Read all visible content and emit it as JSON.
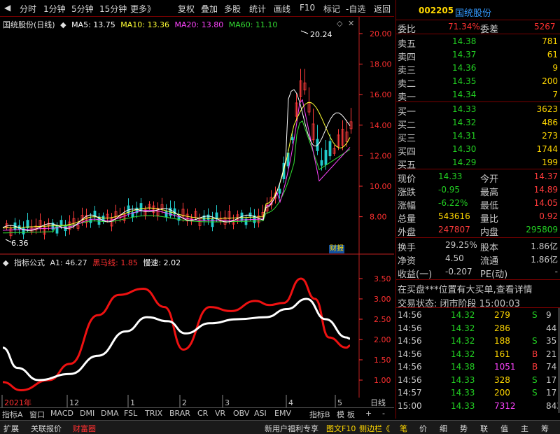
{
  "toolbar": {
    "items": [
      "分时",
      "1分钟",
      "5分钟",
      "15分钟",
      "更多》",
      "复权",
      "叠加",
      "多股",
      "统计",
      "画线",
      "F10",
      "标记",
      "-自选",
      "返回"
    ]
  },
  "stock": {
    "code": "002205",
    "name": "国统股份"
  },
  "price_legend": {
    "title": "国统股份(日线)",
    "ma5": "MA5: 13.75",
    "ma10": "MA10: 13.36",
    "ma20": "MA20: 13.80",
    "ma60": "MA60: 11.10",
    "high_label": "20.24",
    "low_label": "6.36",
    "badge": "财报"
  },
  "indicator_legend": {
    "title": "指标公式",
    "a1": "A1: 46.27",
    "hmx": "黑马线: 1.85",
    "ms": "慢速: 2.02"
  },
  "price_axis": [
    "20.00",
    "18.00",
    "16.00",
    "14.00",
    "12.00",
    "10.00",
    "8.00"
  ],
  "ind_axis": [
    "3.50",
    "3.00",
    "2.50",
    "2.00",
    "1.50",
    "1.00"
  ],
  "time_axis": [
    "2021年",
    "12",
    "1",
    "2",
    "3",
    "4",
    "5",
    "日线"
  ],
  "indicator_tabs": [
    "指标A",
    "窗口",
    "MACD",
    "DMI",
    "DMA",
    "FSL",
    "TRIX",
    "BRAR",
    "CR",
    "VR",
    "OBV",
    "ASI",
    "EMV",
    "指标B",
    "模",
    "板",
    "+",
    "-"
  ],
  "status_bar": {
    "left": [
      "扩展",
      "关联报价",
      "财富圈"
    ],
    "middle": [
      "新用户福利专享",
      "图文F10",
      "侧边栏《"
    ],
    "right": [
      "笔",
      "价",
      "细",
      "势",
      "联",
      "值",
      "主",
      "筹"
    ]
  },
  "quote": {
    "weibi_label": "委比",
    "weibi": "71.34%",
    "weicha_label": "委差",
    "weicha": "5267",
    "asks": [
      {
        "label": "卖五",
        "price": "14.38",
        "vol": "781"
      },
      {
        "label": "卖四",
        "price": "14.37",
        "vol": "61"
      },
      {
        "label": "卖三",
        "price": "14.36",
        "vol": "9"
      },
      {
        "label": "卖二",
        "price": "14.35",
        "vol": "200"
      },
      {
        "label": "卖一",
        "price": "14.34",
        "vol": "7"
      }
    ],
    "bids": [
      {
        "label": "买一",
        "price": "14.33",
        "vol": "3623"
      },
      {
        "label": "买二",
        "price": "14.32",
        "vol": "486"
      },
      {
        "label": "买三",
        "price": "14.31",
        "vol": "273"
      },
      {
        "label": "买四",
        "price": "14.30",
        "vol": "1744"
      },
      {
        "label": "买五",
        "price": "14.29",
        "vol": "199"
      }
    ],
    "stats": [
      {
        "l1": "现价",
        "v1": "14.33",
        "l2": "今开",
        "v2": "14.37"
      },
      {
        "l1": "涨跌",
        "v1": "-0.95",
        "l2": "最高",
        "v2": "14.89"
      },
      {
        "l1": "涨幅",
        "v1": "-6.22%",
        "l2": "最低",
        "v2": "14.05"
      },
      {
        "l1": "总量",
        "v1": "543616",
        "l2": "量比",
        "v2": "0.92"
      },
      {
        "l1": "外盘",
        "v1": "247807",
        "l2": "内盘",
        "v2": "295809"
      }
    ],
    "stats2": [
      {
        "l1": "换手",
        "v1": "29.25%",
        "l2": "股本",
        "v2": "1.86亿"
      },
      {
        "l1": "净资",
        "v1": "4.50",
        "l2": "流通",
        "v2": "1.86亿"
      },
      {
        "l1": "收益(一)",
        "v1": "-0.207",
        "l2": "PE(动)",
        "v2": "-"
      }
    ],
    "notice": "在买盘***位置有大买单,查看详情",
    "trade_status": "交易状态: 闭市阶段 15:00:03",
    "ticks": [
      {
        "t": "14:56",
        "p": "14.32",
        "v": "279",
        "s": "S",
        "n": "9"
      },
      {
        "t": "14:56",
        "p": "14.32",
        "v": "286",
        "s": "",
        "n": "44"
      },
      {
        "t": "14:56",
        "p": "14.32",
        "v": "188",
        "s": "S",
        "n": "35"
      },
      {
        "t": "14:56",
        "p": "14.32",
        "v": "161",
        "s": "B",
        "n": "21"
      },
      {
        "t": "14:56",
        "p": "14.38",
        "v": "1051",
        "s": "B",
        "n": "74"
      },
      {
        "t": "14:56",
        "p": "14.33",
        "v": "328",
        "s": "S",
        "n": "17"
      },
      {
        "t": "14:57",
        "p": "14.33",
        "v": "200",
        "s": "S",
        "n": "17"
      },
      {
        "t": "15:00",
        "p": "14.33",
        "v": "7312",
        "s": "",
        "n": "843"
      }
    ]
  },
  "colors": {
    "up": "#ff3b3b",
    "down": "#22d022",
    "ma5": "#ffffff",
    "ma10": "#ffff33",
    "ma20": "#ff44ff",
    "ma60": "#33dd33",
    "axis": "#ff3030",
    "gold": "#ffd700"
  }
}
